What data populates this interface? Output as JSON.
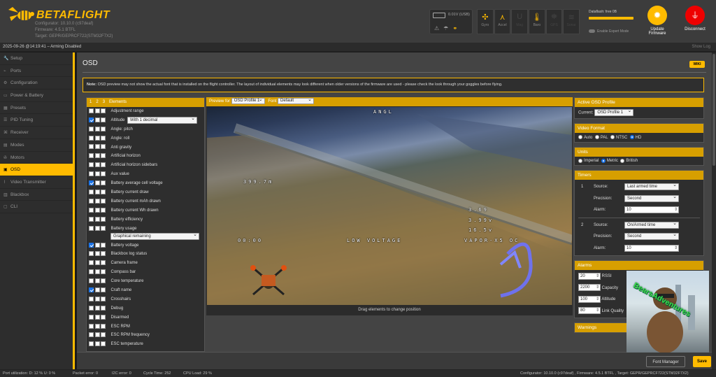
{
  "app": {
    "brand": "BETAFLIGHT",
    "configurator": "Configurator: 10.10.0 (c97deaf)",
    "firmware": "Firmware: 4.5.1 BTFL",
    "target": "Target: GEPR/GEPRCF722(STM32F7X2)"
  },
  "header": {
    "voltage": "0.01V (USB)",
    "sensors": [
      {
        "label": "Gyro",
        "icon": "gyro-icon",
        "active": true
      },
      {
        "label": "Accel",
        "icon": "accel-icon",
        "active": true
      },
      {
        "label": "Mag",
        "icon": "mag-icon",
        "active": false
      },
      {
        "label": "Baro",
        "icon": "baro-icon",
        "active": true
      },
      {
        "label": "GPS",
        "icon": "gps-icon",
        "active": false
      },
      {
        "label": "Sonar",
        "icon": "sonar-icon",
        "active": false
      }
    ],
    "dataflash": "Dataflash: free 0B",
    "expert_mode": "Enable Expert Mode",
    "update_label": "Update Firmware",
    "disconnect_label": "Disconnect"
  },
  "status": {
    "text": "2025-09-26 @14:19:41 – Arming Disabled",
    "show_log": "Show Log"
  },
  "sidebar": {
    "items": [
      {
        "label": "Setup",
        "icon": "wrench-icon"
      },
      {
        "label": "Ports",
        "icon": "plug-icon"
      },
      {
        "label": "Configuration",
        "icon": "gear-icon"
      },
      {
        "label": "Power & Battery",
        "icon": "battery-icon"
      },
      {
        "label": "Presets",
        "icon": "presets-icon"
      },
      {
        "label": "PID Tuning",
        "icon": "pid-icon"
      },
      {
        "label": "Receiver",
        "icon": "receiver-icon"
      },
      {
        "label": "Modes",
        "icon": "modes-icon"
      },
      {
        "label": "Motors",
        "icon": "motor-icon"
      },
      {
        "label": "OSD",
        "icon": "osd-icon",
        "active": true
      },
      {
        "label": "Video Transmitter",
        "icon": "vtx-icon"
      },
      {
        "label": "Blackbox",
        "icon": "blackbox-icon"
      },
      {
        "label": "CLI",
        "icon": "cli-icon"
      }
    ]
  },
  "osd": {
    "title": "OSD",
    "wiki": "WIKI",
    "note_bold": "Note:",
    "note": " OSD preview may not show the actual font that is installed on the flight controller. The layout of individual elements may look different when older versions of the firmware are used - please check the look through your goggles before flying.",
    "elements_header": {
      "tabs": [
        "1",
        "2",
        "3"
      ],
      "title": "Elements"
    },
    "elements": [
      {
        "label": "Adjustment range",
        "checked": false
      },
      {
        "label": "Altitude",
        "checked": true,
        "select": "With 1 decimal"
      },
      {
        "label": "Angle: pitch",
        "checked": false
      },
      {
        "label": "Angle: roll",
        "checked": false
      },
      {
        "label": "Anti gravity",
        "checked": false
      },
      {
        "label": "Artificial horizon",
        "checked": false
      },
      {
        "label": "Artificial horizon sidebars",
        "checked": false
      },
      {
        "label": "Aux value",
        "checked": false
      },
      {
        "label": "Battery average cell voltage",
        "checked": true
      },
      {
        "label": "Battery current draw",
        "checked": false
      },
      {
        "label": "Battery current mAh drawn",
        "checked": false
      },
      {
        "label": "Battery current Wh drawn",
        "checked": false
      },
      {
        "label": "Battery efficiency",
        "checked": false
      },
      {
        "label": "Battery usage",
        "checked": false,
        "select": "Graphical remaining",
        "tall": true
      },
      {
        "label": "Battery voltage",
        "checked": true
      },
      {
        "label": "Blackbox log status",
        "checked": false
      },
      {
        "label": "Camera frame",
        "checked": false
      },
      {
        "label": "Compass bar",
        "checked": false
      },
      {
        "label": "Core temperature",
        "checked": false
      },
      {
        "label": "Craft name",
        "checked": true
      },
      {
        "label": "Crosshairs",
        "checked": false
      },
      {
        "label": "Debug",
        "checked": false
      },
      {
        "label": "Disarmed",
        "checked": false
      },
      {
        "label": "ESC RPM",
        "checked": false
      },
      {
        "label": "ESC RPM frequency",
        "checked": false
      },
      {
        "label": "ESC temperature",
        "checked": false
      }
    ],
    "preview": {
      "preview_for_label": "Preview for",
      "profile": "OSD Profile 1",
      "font_label": "Font",
      "font": "Default",
      "drag_hint": "Drag elements to change position",
      "osd_texts": {
        "top": "ANGL",
        "altitude": "399.7m",
        "voltage_top": "3.69",
        "voltage_mid": "3.99v",
        "voltage_bot": "16.5v",
        "left_timer": "00:00",
        "warning": "LOW VOLTAGE",
        "craft": "VAPOR-X5 OC"
      }
    },
    "active_profile": {
      "title": "Active OSD Profile",
      "current_label": "Current:",
      "current": "OSD Profile 1"
    },
    "video_format": {
      "title": "Video Format",
      "options": [
        "Auto",
        "PAL",
        "NTSC",
        "HD"
      ],
      "selected": "HD"
    },
    "units": {
      "title": "Units",
      "options": [
        "Imperial",
        "Metric",
        "British"
      ],
      "selected": "Metric"
    },
    "timers": {
      "title": "Timers",
      "items": [
        {
          "num": "1",
          "source_label": "Source:",
          "source": "Last armed time",
          "precision_label": "Precision:",
          "precision": "Second",
          "alarm_label": "Alarm:",
          "alarm": "10"
        },
        {
          "num": "2",
          "source_label": "Source:",
          "source": "On/Armed time",
          "precision_label": "Precision:",
          "precision": "Second",
          "alarm_label": "Alarm:",
          "alarm": "10"
        }
      ]
    },
    "alarms": {
      "title": "Alarms",
      "items": [
        {
          "value": "20",
          "label": "RSSI"
        },
        {
          "value": "2200",
          "label": "Capacity"
        },
        {
          "value": "100",
          "label": "Altitude"
        },
        {
          "value": "80",
          "label": "Link Quality"
        }
      ]
    },
    "warnings": {
      "title": "Warnings"
    },
    "font_manager": "Font Manager",
    "save": "Save"
  },
  "footer": {
    "port_util": "Port utilization: D: 12 % U: 0 %",
    "packet_error": "Packet error: 0",
    "i2c_error": "I2C error: 0",
    "cycle_time": "Cycle Time: 252",
    "cpu_load": "CPU Load: 29 %",
    "version": "Configurator: 10.10.0 (c97deaf) , Firmware: 4.5.1 BTFL , Target: GEPR/GEPRCF722(STM32F7X2)"
  },
  "watermark": "BearsAdventures",
  "colors": {
    "accent": "#ffbb00",
    "header_bar": "#d79f00",
    "disconnect": "#e00000",
    "checked": "#1a73e8"
  }
}
